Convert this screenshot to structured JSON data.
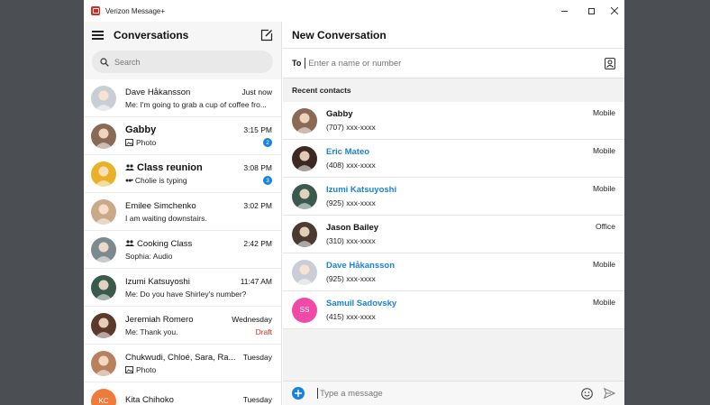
{
  "window": {
    "title": "Verizon Message+"
  },
  "left": {
    "title": "Conversations",
    "search_placeholder": "Search",
    "conversations": [
      {
        "name": "Dave Håkansson",
        "time": "Just now",
        "snippet": "Me: I'm going to grab a cup of coffee fro...",
        "bold": false,
        "badge": "",
        "draft": "",
        "icon": "",
        "avatar_color": "#c9ced6"
      },
      {
        "name": "Gabby",
        "time": "3:15 PM",
        "snippet": "Photo",
        "bold": true,
        "badge": "2",
        "draft": "",
        "icon": "photo-icon",
        "avatar_color": "#8a6a55"
      },
      {
        "name": "Class reunion",
        "time": "3:08 PM",
        "snippet": "Cholie is typing",
        "bold": true,
        "badge": "3",
        "draft": "",
        "icon": "group-icon",
        "avatar_color": "#e8b128"
      },
      {
        "name": "Emilee Simchenko",
        "time": "3:02 PM",
        "snippet": "I am waiting downstairs.",
        "bold": false,
        "badge": "",
        "draft": "",
        "icon": "",
        "avatar_color": "#caa98a"
      },
      {
        "name": "Cooking Class",
        "time": "2:42 PM",
        "snippet": "Sophia: Audio",
        "bold": false,
        "badge": "",
        "draft": "",
        "icon": "group-icon",
        "avatar_color": "#7c8a90"
      },
      {
        "name": "Izumi Katsuyoshi",
        "time": "11:47 AM",
        "snippet": "Me: Do you have Shirley's number?",
        "bold": false,
        "badge": "",
        "draft": "",
        "icon": "",
        "avatar_color": "#3a5a4e"
      },
      {
        "name": "Jeremiah Romero",
        "time": "Wednesday",
        "snippet": "Me: Thank you.",
        "bold": false,
        "badge": "",
        "draft": "Draft",
        "icon": "",
        "avatar_color": "#5b3a2c"
      },
      {
        "name": "Chukwudi, Chloé, Sara, Ra...",
        "time": "Tuesday",
        "snippet": "Photo",
        "bold": false,
        "badge": "",
        "draft": "",
        "icon": "photo-icon",
        "avatar_color": "#b98060"
      },
      {
        "name": "Kita Chihoko",
        "time": "Tuesday",
        "snippet": "",
        "bold": false,
        "badge": "",
        "draft": "",
        "icon": "",
        "avatar_color": "#f07a3a",
        "initials": "KC"
      }
    ]
  },
  "right": {
    "title": "New Conversation",
    "to_label": "To",
    "to_placeholder": "Enter a name or number",
    "recent_label": "Recent contacts",
    "contacts": [
      {
        "name": "Gabby",
        "phone": "(707) xxx-xxxx",
        "type": "Mobile",
        "highlight": false,
        "avatar_color": "#8a6a55"
      },
      {
        "name": "Eric Mateo",
        "phone": "(408) xxx-xxxx",
        "type": "Mobile",
        "highlight": true,
        "avatar_color": "#3a2a22"
      },
      {
        "name": "Izumi Katsuyoshi",
        "phone": "(925) xxx-xxxx",
        "type": "Mobile",
        "highlight": true,
        "avatar_color": "#3a5a4e"
      },
      {
        "name": "Jason Bailey",
        "phone": "(310) xxx-xxxx",
        "type": "Office",
        "highlight": false,
        "avatar_color": "#4a3a30"
      },
      {
        "name": "Dave Håkansson",
        "phone": "(925) xxx-xxxx",
        "type": "Mobile",
        "highlight": true,
        "avatar_color": "#c9ced6"
      },
      {
        "name": "Samuil Sadovsky",
        "phone": "(415) xxx-xxxx",
        "type": "Mobile",
        "highlight": true,
        "avatar_color": "#ef4aa6",
        "initials": "SS"
      }
    ],
    "message_placeholder": "Type a message"
  },
  "colors": {
    "accent": "#1a82d8",
    "brand": "#d52b1e",
    "draft": "#d52b1e"
  }
}
